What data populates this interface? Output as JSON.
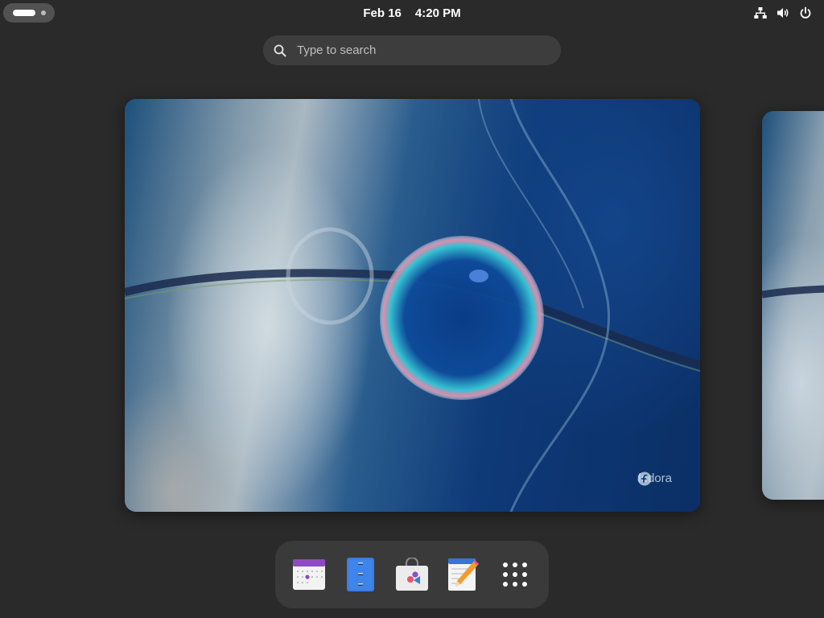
{
  "topbar": {
    "date": "Feb 16",
    "time": "4:20 PM",
    "status_icons": [
      "network-wired-icon",
      "volume-icon",
      "power-icon"
    ]
  },
  "search": {
    "placeholder": "Type to search",
    "value": ""
  },
  "workspaces": [
    {
      "label": "fedora",
      "active": true
    },
    {
      "label": "",
      "active": false
    }
  ],
  "dash": {
    "apps": [
      {
        "name": "Calendar",
        "icon": "calendar-icon"
      },
      {
        "name": "Files",
        "icon": "files-icon"
      },
      {
        "name": "Software",
        "icon": "software-icon"
      },
      {
        "name": "Text Editor",
        "icon": "text-editor-icon"
      },
      {
        "name": "Show Apps",
        "icon": "app-grid-icon"
      }
    ]
  },
  "colors": {
    "background": "#2a2a2a",
    "search_bg": "#3d3d3d",
    "dash_bg": "#3a3a3a"
  }
}
